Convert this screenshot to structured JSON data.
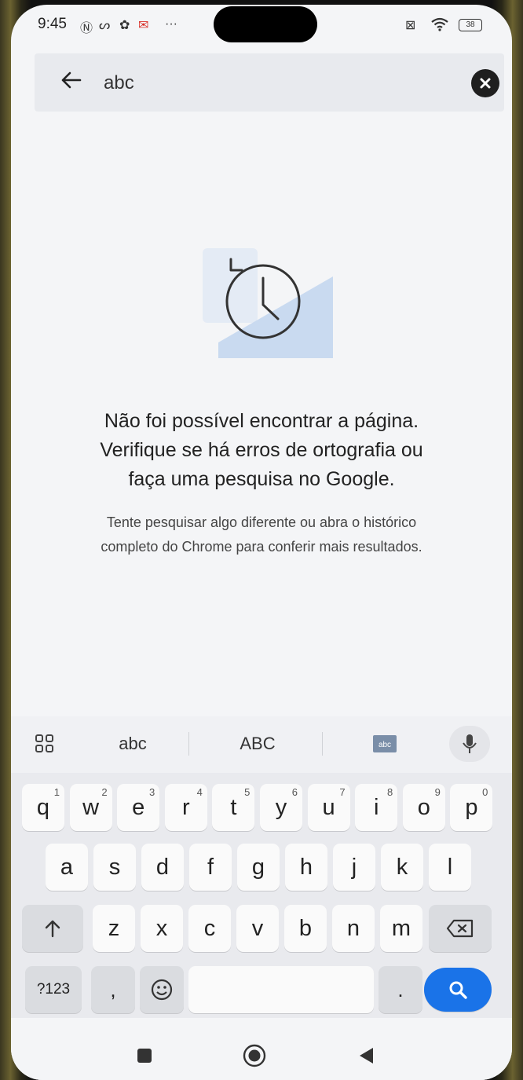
{
  "status_bar": {
    "time": "9:45",
    "battery": "38"
  },
  "search": {
    "value": "abc"
  },
  "empty_state": {
    "title_line1": "Não foi possível encontrar a página.",
    "title_line2": "Verifique se há erros de ortografia ou",
    "title_line3": "faça uma pesquisa no Google.",
    "sub_line1": "Tente pesquisar algo diferente ou abra o histórico",
    "sub_line2": "completo do Chrome para conferir mais resultados."
  },
  "keyboard_toolbar": {
    "lower_label": "abc",
    "upper_label": "ABC"
  },
  "keyboard": {
    "row1": [
      {
        "key": "q",
        "hint": "1"
      },
      {
        "key": "w",
        "hint": "2"
      },
      {
        "key": "e",
        "hint": "3"
      },
      {
        "key": "r",
        "hint": "4"
      },
      {
        "key": "t",
        "hint": "5"
      },
      {
        "key": "y",
        "hint": "6"
      },
      {
        "key": "u",
        "hint": "7"
      },
      {
        "key": "i",
        "hint": "8"
      },
      {
        "key": "o",
        "hint": "9"
      },
      {
        "key": "p",
        "hint": "0"
      }
    ],
    "row2": [
      "a",
      "s",
      "d",
      "f",
      "g",
      "h",
      "j",
      "k",
      "l"
    ],
    "row3": [
      "z",
      "x",
      "c",
      "v",
      "b",
      "n",
      "m"
    ],
    "symbols_label": "?123",
    "comma": ",",
    "period": "."
  },
  "colors": {
    "accent": "#1a73e8",
    "illustration": "#c9daf0"
  }
}
